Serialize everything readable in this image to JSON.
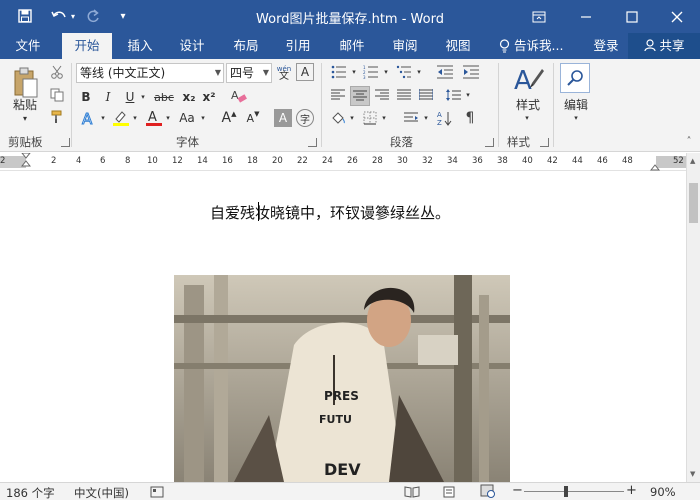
{
  "window": {
    "title": "Word图片批量保存.htm - Word"
  },
  "tabs": [
    "文件",
    "开始",
    "插入",
    "设计",
    "布局",
    "引用",
    "邮件",
    "审阅",
    "视图"
  ],
  "tell_me": "告诉我...",
  "login": "登录",
  "share": "共享",
  "clipboard": {
    "paste_label": "粘贴",
    "group_label": "剪贴板"
  },
  "font": {
    "name": "等线 (中文正文)",
    "size": "四号",
    "group_label": "字体",
    "wen_icon_text": "wén",
    "bold": "B",
    "italic": "I",
    "underline": "U",
    "strike": "abc",
    "subscript": "x₂",
    "superscript": "x²",
    "big_a": "A",
    "grow_a": "A",
    "shrink_a": "A",
    "aa": "Aa",
    "char_shade": "A",
    "enclose": "字"
  },
  "paragraph": {
    "group_label": "段落"
  },
  "styles": {
    "label": "样式",
    "group_label": "样式"
  },
  "editing": {
    "label": "编辑"
  },
  "ruler": {
    "ticks": [
      "2",
      "2",
      "4",
      "6",
      "8",
      "10",
      "12",
      "14",
      "16",
      "18",
      "20",
      "22",
      "24",
      "26",
      "28",
      "30",
      "32",
      "34",
      "36",
      "38",
      "40",
      "42",
      "44",
      "46",
      "48",
      "52"
    ]
  },
  "document": {
    "text": "自爱残妆晓镜中，环钗谩篸绿丝丛。"
  },
  "status": {
    "word_count": "186 个字",
    "language": "中文(中国)",
    "zoom": "90%"
  },
  "colors": {
    "accent": "#2b579a",
    "ribbon": "#f3f3f3",
    "highlight": "#ffff00",
    "font_color": "#e02020"
  }
}
